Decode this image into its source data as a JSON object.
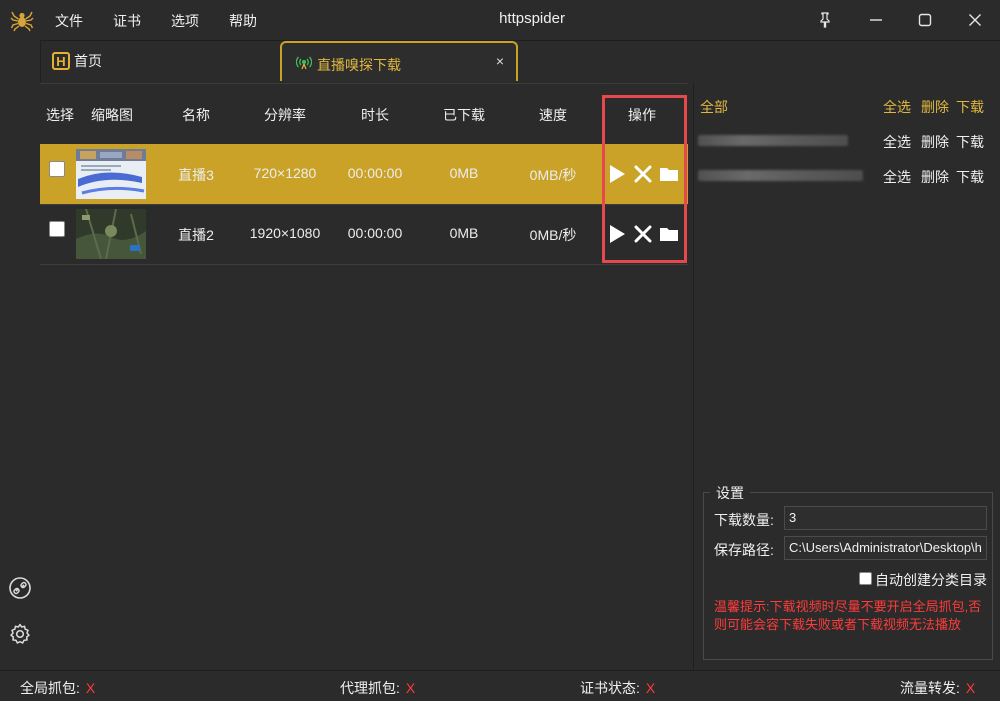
{
  "titlebar": {
    "title": "httpspider",
    "menu": [
      "文件",
      "证书",
      "选项",
      "帮助"
    ]
  },
  "tabs": {
    "home_label": "首页",
    "active_label": "直播嗅探下载",
    "close_glyph": "×"
  },
  "table": {
    "headers": [
      "选择",
      "缩略图",
      "名称",
      "分辨率",
      "时长",
      "已下载",
      "速度",
      "操作"
    ],
    "rows": [
      {
        "name": "直播3",
        "resolution": "720×1280",
        "duration": "00:00:00",
        "downloaded": "0MB",
        "speed": "0MB/秒",
        "selected": true,
        "checked": false
      },
      {
        "name": "直播2",
        "resolution": "1920×1080",
        "duration": "00:00:00",
        "downloaded": "0MB",
        "speed": "0MB/秒",
        "selected": false,
        "checked": false
      }
    ],
    "row_actions": [
      "play-icon",
      "close-icon",
      "folder-icon"
    ]
  },
  "categories": {
    "all_label": "全部",
    "actions": {
      "select_all": "全选",
      "delete": "删除",
      "download": "下载"
    }
  },
  "settings": {
    "legend": "设置",
    "count_label": "下载数量:",
    "count_value": "3",
    "path_label": "保存路径:",
    "path_value": "C:\\Users\\Administrator\\Desktop\\h",
    "auto_dir_label": "自动创建分类目录",
    "auto_dir_checked": false,
    "warning": "温馨提示:下载视频时尽量不要开启全局抓包,否则可能会容下载失败或者下载视频无法播放"
  },
  "status": {
    "global_capture": "全局抓包:",
    "proxy_capture": "代理抓包:",
    "cert_status": "证书状态:",
    "traffic_forward": "流量转发:",
    "off_mark": "X"
  },
  "colors": {
    "accent": "#c9a227",
    "accent_text": "#e0b840",
    "danger": "#ff3b3b",
    "highlight_box": "#e5484d",
    "background": "#2b2b2b"
  }
}
